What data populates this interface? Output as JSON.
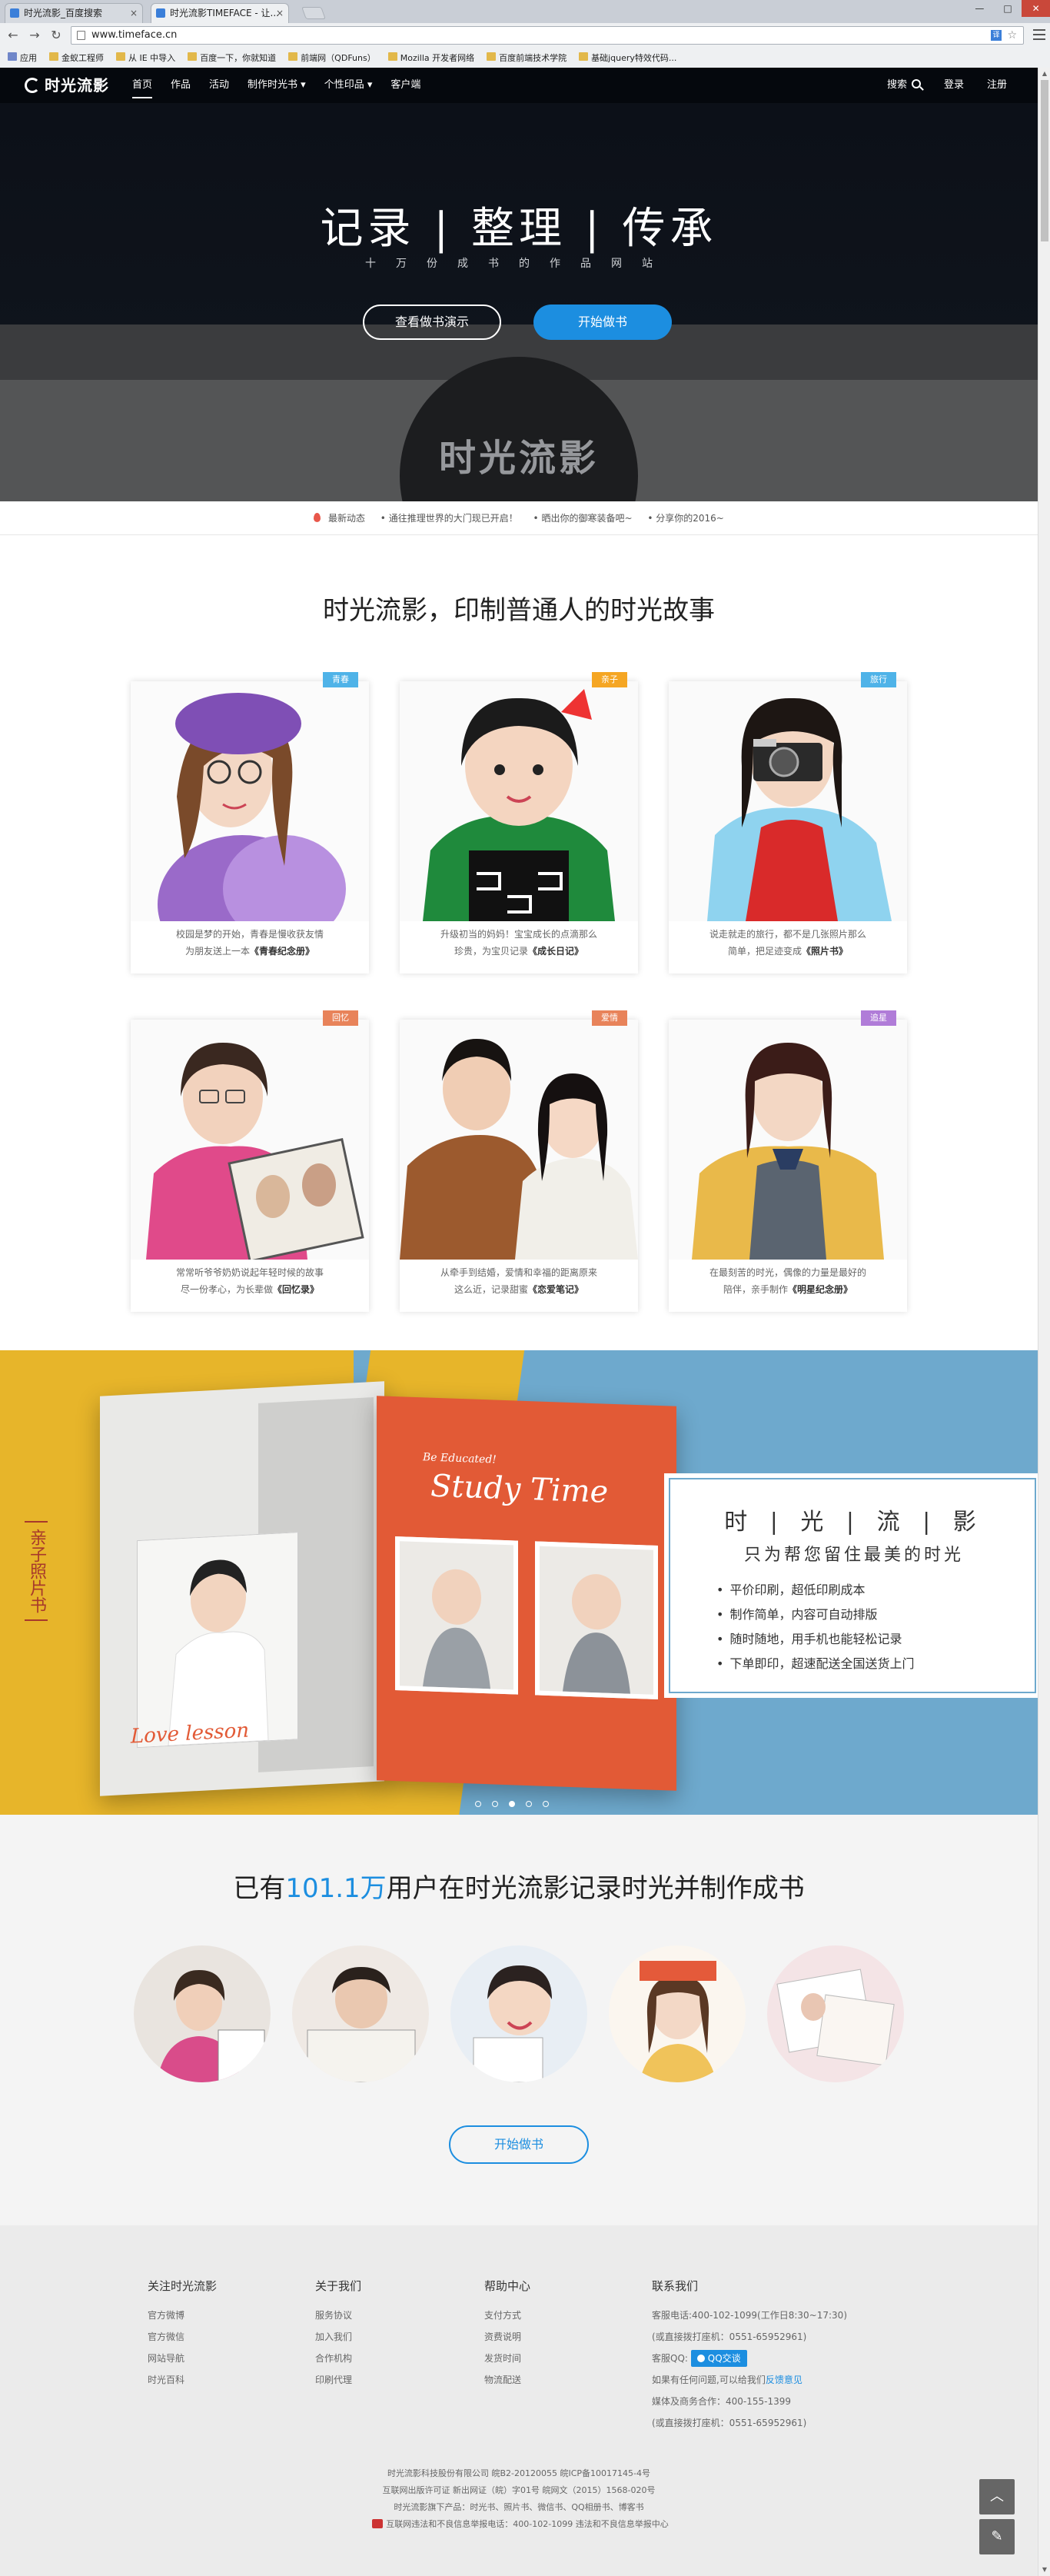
{
  "browser": {
    "tabs": [
      {
        "title": "时光流影_百度搜索",
        "active": false
      },
      {
        "title": "时光流影TIMEFACE - 让...",
        "active": true
      }
    ],
    "url": "www.timeface.cn",
    "bookmarks": [
      "应用",
      "金蚁工程师",
      "从 IE 中导入",
      "百度一下，你就知道",
      "前端网（QDFuns）",
      "Mozilla 开发者网络",
      "百度前端技术学院",
      "基础jquery特效代码..."
    ]
  },
  "site_nav": {
    "logo": "时光流影",
    "items": [
      {
        "label": "首页",
        "active": true
      },
      {
        "label": "作品",
        "active": false
      },
      {
        "label": "活动",
        "active": false
      },
      {
        "label": "制作时光书 ▾",
        "active": false
      },
      {
        "label": "个性印品 ▾",
        "active": false
      },
      {
        "label": "客户端",
        "active": false
      }
    ],
    "search": "搜索",
    "login": "登录",
    "register": "注册"
  },
  "hero": {
    "title": "记录 | 整理 | 传承",
    "subtitle": "十万份成书的作品网站",
    "demo_button": "查看做书演示",
    "start_button": "开始做书",
    "brand_watermark": "时光流影"
  },
  "news": {
    "label": "最新动态",
    "items": [
      "通往推理世界的大门现已开启！",
      "晒出你的御寒装备吧~",
      "分享你的2016~"
    ]
  },
  "stories": {
    "title": "时光流影，印制普通人的时光故事",
    "cards": [
      {
        "tag": "青春",
        "tag_color": "#4fb3e8",
        "text": "校园是梦的开始，青春是慢收获友情",
        "text2": "为朋友送上一本",
        "book": "《青春纪念册》"
      },
      {
        "tag": "亲子",
        "tag_color": "#f5a623",
        "text": "升级初当的妈妈！宝宝成长的点滴那么",
        "text2": "珍贵，为宝贝记录",
        "book": "《成长日记》"
      },
      {
        "tag": "旅行",
        "tag_color": "#4fb3e8",
        "text": "说走就走的旅行，都不是几张照片那么",
        "text2": "简单，把足迹变成",
        "book": "《照片书》"
      },
      {
        "tag": "回忆",
        "tag_color": "#e8835a",
        "text": "常常听爷爷奶奶说起年轻时候的故事",
        "text2": "尽一份孝心，为长辈做",
        "book": "《回忆录》"
      },
      {
        "tag": "爱情",
        "tag_color": "#e8835a",
        "text": "从牵手到结婚，爱情和幸福的距离原来",
        "text2": "这么近，记录甜蜜",
        "book": "《恋爱笔记》"
      },
      {
        "tag": "追星",
        "tag_color": "#b07cd8",
        "text": "在最刻苦的时光，偶像的力量是最好的",
        "text2": "陪伴，亲手制作",
        "book": "《明星纪念册》"
      }
    ]
  },
  "banner": {
    "side_label": "亲子照片书",
    "book_heading_small": "Be Educated!",
    "book_heading": "Study Time",
    "book_script": "Love lesson",
    "promo_title": "时 | 光 | 流 | 影",
    "promo_subtitle": "只为帮您留住最美的时光",
    "features": [
      "平价印刷，超低印刷成本",
      "制作简单，内容可自动排版",
      "随时随地，用手机也能轻松记录",
      "下单即印，超速配送全国送货上门"
    ],
    "dots": 5,
    "active_dot": 3
  },
  "users": {
    "title_prefix": "已有",
    "count": "101.1万",
    "title_suffix": "用户在时光流影记录时光并制作成书",
    "start_button": "开始做书"
  },
  "footer": {
    "columns": [
      {
        "heading": "关注时光流影",
        "links": [
          "官方微博",
          "官方微信",
          "网站导航",
          "时光百科"
        ]
      },
      {
        "heading": "关于我们",
        "links": [
          "服务协议",
          "加入我们",
          "合作机构",
          "印刷代理"
        ]
      },
      {
        "heading": "帮助中心",
        "links": [
          "支付方式",
          "资费说明",
          "发货时间",
          "物流配送"
        ]
      }
    ],
    "contact": {
      "heading": "联系我们",
      "phone": "客服电话:400-102-1099(工作日8:30~17:30)",
      "phone_alt": "(或直接拨打座机：0551-65952961)",
      "qq_label": "客服QQ:",
      "qq_button": "QQ交谈",
      "feedback_prefix": "如果有任何问题,可以给我们",
      "feedback_link": "反馈意见",
      "business": "媒体及商务合作：400-155-1399",
      "business_alt": "(或直接拨打座机：0551-65952961)"
    },
    "copyright": [
      "时光流影科技股份有限公司 皖B2-20120055 皖ICP备10017145-4号",
      "互联网出版许可证 新出网证（皖）字01号 皖网文（2015）1568-020号",
      "时光流影旗下产品：时光书、照片书、微信书、QQ相册书、博客书",
      "互联网违法和不良信息举报电话：400-102-1099  违法和不良信息举报中心"
    ],
    "back_to_top": "︿",
    "feedback_button": "✎"
  },
  "colors": {
    "accent": "#1c8ee0",
    "nav_bg": "#05080d"
  }
}
